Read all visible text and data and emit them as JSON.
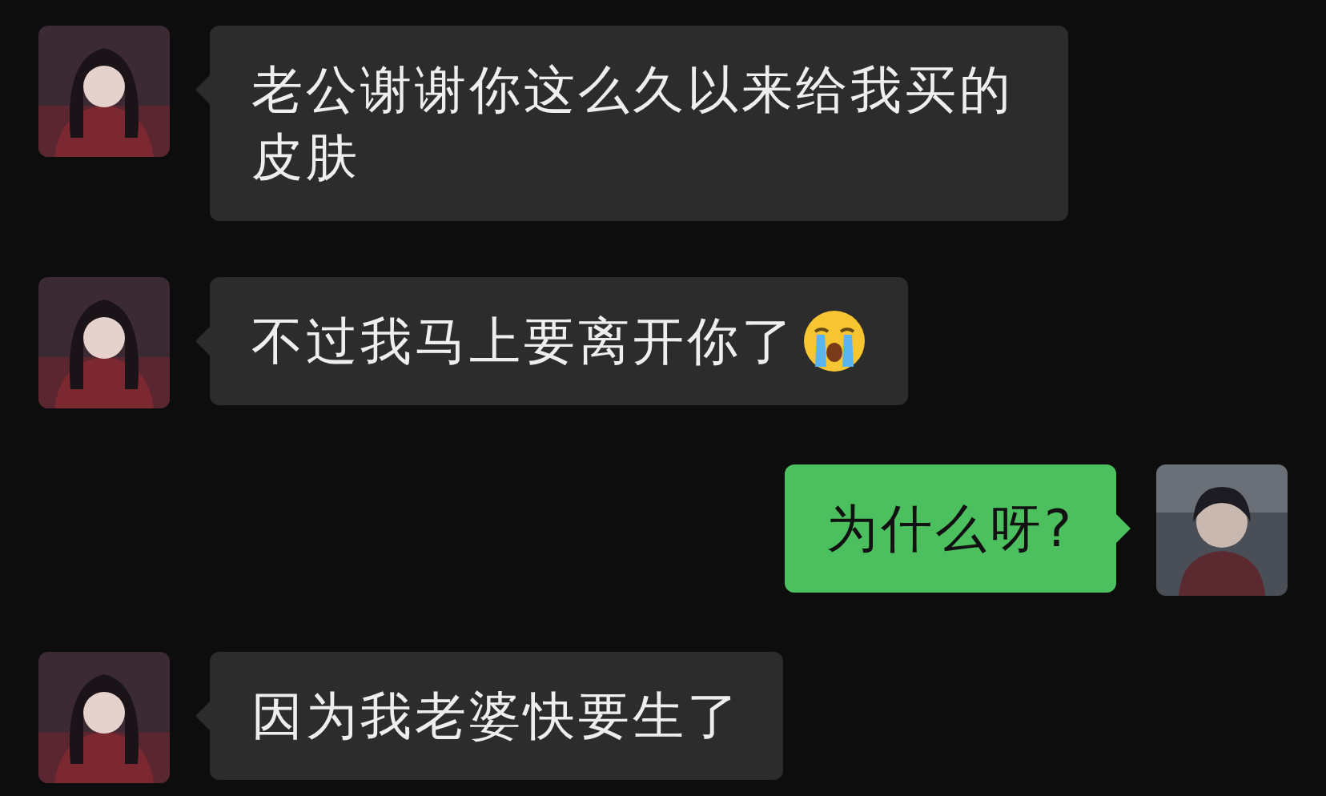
{
  "messages": [
    {
      "outgoing": false,
      "text": "老公谢谢你这么久以来给我买的皮肤",
      "trailing_icon": false
    },
    {
      "outgoing": false,
      "text": "不过我马上要离开你了",
      "trailing_icon": true
    },
    {
      "outgoing": true,
      "text": "为什么呀?",
      "trailing_icon": false
    },
    {
      "outgoing": false,
      "text": "因为我老婆快要生了",
      "trailing_icon": false
    }
  ]
}
